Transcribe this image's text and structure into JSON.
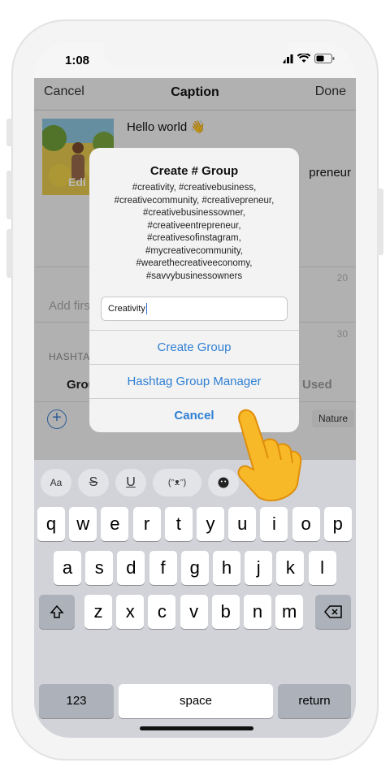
{
  "status": {
    "time": "1:08"
  },
  "nav": {
    "cancel": "Cancel",
    "title": "Caption",
    "done": "Done"
  },
  "post": {
    "thumbnail_label": "Edi",
    "caption_line1": "Hello world 👋",
    "caption_partial": "preneur"
  },
  "fields": {
    "counter1": "20",
    "first_placeholder": "Add firs",
    "counter2": "30",
    "hashtags_label": "HASHTA",
    "tab_groups": "Grou",
    "tab_used": "Used",
    "chip_nature": "Nature"
  },
  "dialog": {
    "title": "Create # Group",
    "message_lines": [
      "#creativity, #creativebusiness,",
      "#creativecommunity, #creativepreneur,",
      "#creativebusinessowner,",
      "#creativeentrepreneur,",
      "#creativesofinstagram,",
      "#mycreativecommunity,",
      "#wearethecreativeeconomy,",
      "#savvybusinessowners"
    ],
    "input_value": "Creativity",
    "create_button": "Create Group",
    "manager_button": "Hashtag Group Manager",
    "cancel_button": "Cancel"
  },
  "toolbar": {
    "aa": "Aa",
    "strike": "S",
    "underline": "U",
    "kaomoji": "(ᵔᴥᵔ)"
  },
  "keyboard": {
    "row1": [
      "q",
      "w",
      "e",
      "r",
      "t",
      "y",
      "u",
      "i",
      "o",
      "p"
    ],
    "row2": [
      "a",
      "s",
      "d",
      "f",
      "g",
      "h",
      "j",
      "k",
      "l"
    ],
    "row3": [
      "z",
      "x",
      "c",
      "v",
      "b",
      "n",
      "m"
    ],
    "numbers": "123",
    "space": "space",
    "return": "return"
  },
  "colors": {
    "accent": "#2f7fd3",
    "keyboard_bg": "#d1d3d9",
    "dark_key": "#adb1b9",
    "hand": "#f7b928"
  }
}
